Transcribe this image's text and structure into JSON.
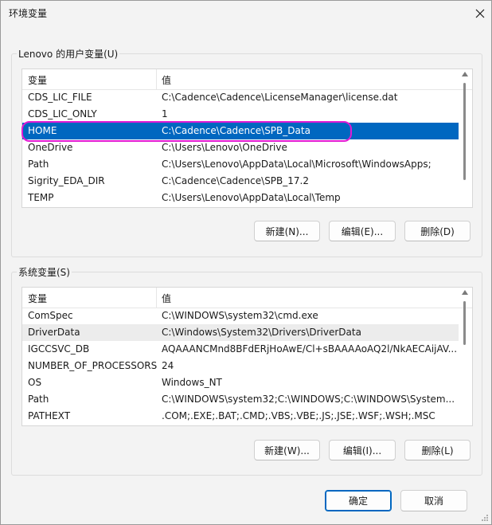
{
  "window": {
    "title": "环境变量"
  },
  "user_vars": {
    "group_label": "Lenovo 的用户变量(U)",
    "col_name": "变量",
    "col_value": "值",
    "rows": [
      {
        "name": "CDS_LIC_FILE",
        "value": "C:\\Cadence\\Cadence\\LicenseManager\\license.dat"
      },
      {
        "name": "CDS_LIC_ONLY",
        "value": "1"
      },
      {
        "name": "HOME",
        "value": "C:\\Cadence\\Cadence\\SPB_Data"
      },
      {
        "name": "OneDrive",
        "value": "C:\\Users\\Lenovo\\OneDrive"
      },
      {
        "name": "Path",
        "value": "C:\\Users\\Lenovo\\AppData\\Local\\Microsoft\\WindowsApps;"
      },
      {
        "name": "Sigrity_EDA_DIR",
        "value": "C:\\Cadence\\Cadence\\SPB_17.2"
      },
      {
        "name": "TEMP",
        "value": "C:\\Users\\Lenovo\\AppData\\Local\\Temp"
      }
    ],
    "buttons": {
      "new": "新建(N)...",
      "edit": "编辑(E)...",
      "delete": "删除(D)"
    }
  },
  "system_vars": {
    "group_label": "系统变量(S)",
    "col_name": "变量",
    "col_value": "值",
    "rows": [
      {
        "name": "ComSpec",
        "value": "C:\\WINDOWS\\system32\\cmd.exe"
      },
      {
        "name": "DriverData",
        "value": "C:\\Windows\\System32\\Drivers\\DriverData"
      },
      {
        "name": "IGCCSVC_DB",
        "value": "AQAAANCMnd8BFdERjHoAwE/Cl+sBAAAAoAQ2l/NkAECAijAV..."
      },
      {
        "name": "NUMBER_OF_PROCESSORS",
        "value": "24"
      },
      {
        "name": "OS",
        "value": "Windows_NT"
      },
      {
        "name": "Path",
        "value": "C:\\WINDOWS\\system32;C:\\WINDOWS;C:\\WINDOWS\\System..."
      },
      {
        "name": "PATHEXT",
        "value": ".COM;.EXE;.BAT;.CMD;.VBS;.VBE;.JS;.JSE;.WSF;.WSH;.MSC"
      }
    ],
    "buttons": {
      "new": "新建(W)...",
      "edit": "编辑(I)...",
      "delete": "删除(L)"
    }
  },
  "footer": {
    "ok": "确定",
    "cancel": "取消"
  },
  "colors": {
    "selection": "#0067c0",
    "annotation": "#e11ad4"
  }
}
